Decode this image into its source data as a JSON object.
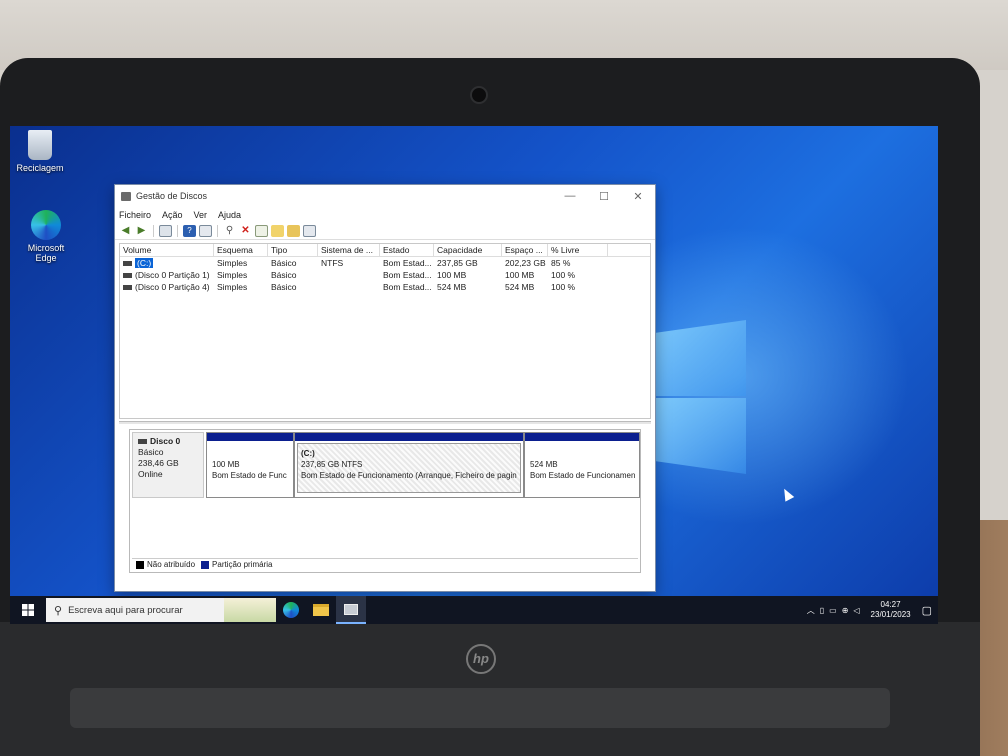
{
  "desktop": {
    "icons": [
      {
        "label": "Reciclagem",
        "icon": "recycle-bin-icon"
      },
      {
        "label": "Microsoft Edge",
        "icon": "edge-icon"
      }
    ]
  },
  "window": {
    "title": "Gestão de Discos",
    "controls": {
      "minimize": "—",
      "maximize": "☐",
      "close": "✕"
    },
    "menu": [
      "Ficheiro",
      "Ação",
      "Ver",
      "Ajuda"
    ]
  },
  "volume_table": {
    "headers": [
      "Volume",
      "Esquema",
      "Tipo",
      "Sistema de ...",
      "Estado",
      "Capacidade",
      "Espaço ...",
      "% Livre"
    ],
    "rows": [
      {
        "volume": "(C:)",
        "esquema": "Simples",
        "tipo": "Básico",
        "sistema": "NTFS",
        "estado": "Bom Estad...",
        "capacidade": "237,85 GB",
        "espaco": "202,23 GB",
        "livre": "85 %"
      },
      {
        "volume": "(Disco 0 Partição 1)",
        "esquema": "Simples",
        "tipo": "Básico",
        "sistema": "",
        "estado": "Bom Estad...",
        "capacidade": "100 MB",
        "espaco": "100 MB",
        "livre": "100 %"
      },
      {
        "volume": "(Disco 0 Partição 4)",
        "esquema": "Simples",
        "tipo": "Básico",
        "sistema": "",
        "estado": "Bom Estad...",
        "capacidade": "524 MB",
        "espaco": "524 MB",
        "livre": "100 %"
      }
    ]
  },
  "disk": {
    "name": "Disco 0",
    "type": "Básico",
    "size": "238,46 GB",
    "status": "Online",
    "partitions": [
      {
        "title": "",
        "size": "100 MB",
        "status": "Bom Estado de Func"
      },
      {
        "title": "(C:)",
        "size": "237,85 GB NTFS",
        "status": "Bom Estado de Funcionamento (Arranque, Ficheiro de pagin"
      },
      {
        "title": "",
        "size": "524 MB",
        "status": "Bom Estado de Funcionamen"
      }
    ]
  },
  "legend": [
    {
      "label": "Não atribuído",
      "color": "#000000"
    },
    {
      "label": "Partição primária",
      "color": "#0b1f8f"
    }
  ],
  "taskbar": {
    "search_placeholder": "Escreva aqui para procurar",
    "time": "04:27",
    "date": "23/01/2023"
  },
  "brand": "hp"
}
